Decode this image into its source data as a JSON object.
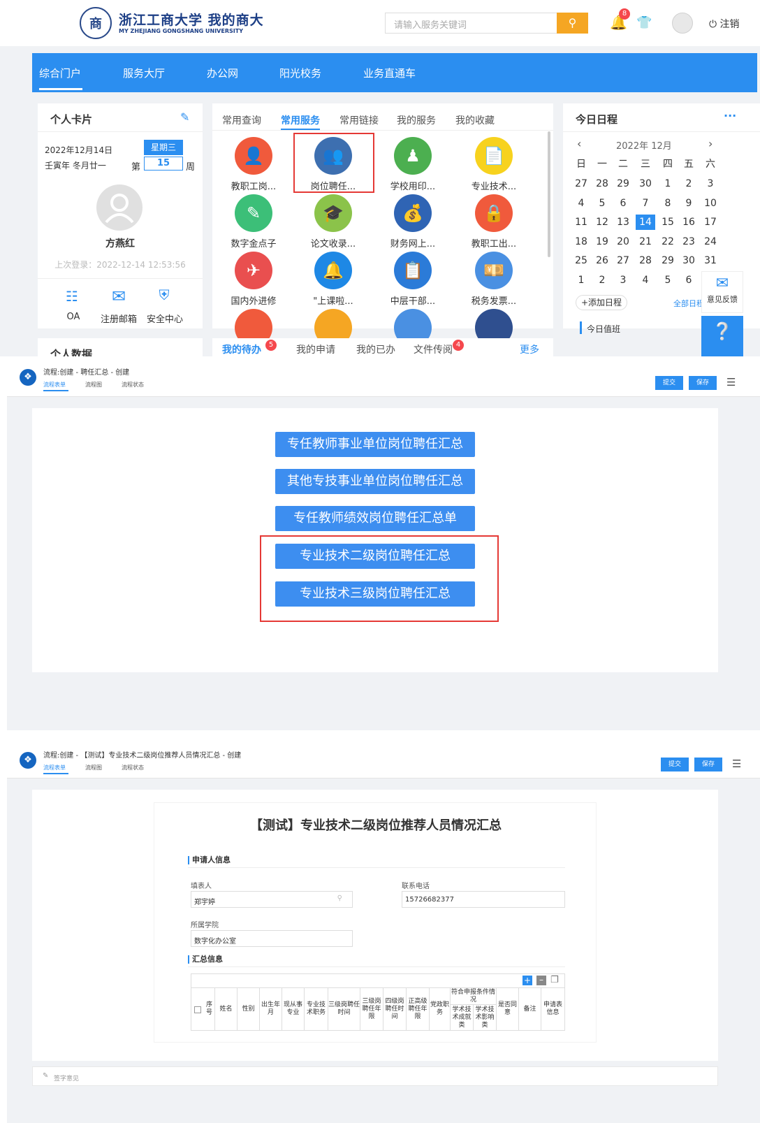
{
  "portal": {
    "logo": {
      "cn": "浙江工商大学",
      "cn2": "我的商大",
      "en": "MY ZHEJIANG GONGSHANG UNIVERSITY",
      "seal": "商"
    },
    "search": {
      "placeholder": "请输入服务关键词",
      "icon": "search-icon"
    },
    "notifications": {
      "count": "8",
      "icon": "bell-icon"
    },
    "shirt_icon": "tshirt-icon",
    "logout": "注销",
    "nav": [
      "综合门户",
      "服务大厅",
      "办公网",
      "阳光校务",
      "业务直通车"
    ],
    "personal_card": {
      "title": "个人卡片",
      "date": "2022年12月14日",
      "lunar": "壬寅年 冬月廿一",
      "weekday": "星期三",
      "week_prefix": "第",
      "week_num": "15",
      "week_suffix": "周",
      "name": "方燕红",
      "last_login": "上次登录：2022-12-14 12:53:56",
      "links": [
        "OA",
        "注册邮箱",
        "安全中心"
      ],
      "next_title": "个人数据"
    },
    "service_tabs": [
      "常用查询",
      "常用服务",
      "常用链接",
      "我的服务",
      "我的收藏"
    ],
    "services": [
      {
        "label": "教职工岗...",
        "color": "#f05a3c"
      },
      {
        "label": "岗位聘任...",
        "color": "#3d6fb0"
      },
      {
        "label": "学校用印...",
        "color": "#4caf50"
      },
      {
        "label": "专业技术...",
        "color": "#f7d21e"
      },
      {
        "label": "数字金点子",
        "color": "#3cbf78"
      },
      {
        "label": "论文收录...",
        "color": "#8bc34a"
      },
      {
        "label": "财务网上...",
        "color": "#2f64b4"
      },
      {
        "label": "教职工出...",
        "color": "#f05a3c"
      },
      {
        "label": "国内外进修",
        "color": "#e94f4f"
      },
      {
        "label": "\"上课啦...",
        "color": "#1e88e5"
      },
      {
        "label": "中层干部...",
        "color": "#2b7bd8"
      },
      {
        "label": "税务发票...",
        "color": "#4a90e2"
      }
    ],
    "todo_tabs": [
      "我的待办",
      "我的申请",
      "我的已办",
      "文件传阅"
    ],
    "todo_badges": [
      "5",
      "4"
    ],
    "todo_more": "更多",
    "schedule": {
      "title": "今日日程",
      "month": "2022年  12月",
      "weekdays": [
        "日",
        "一",
        "二",
        "三",
        "四",
        "五",
        "六"
      ],
      "days": [
        [
          "27",
          "28",
          "29",
          "30",
          "1",
          "2",
          "3"
        ],
        [
          "4",
          "5",
          "6",
          "7",
          "8",
          "9",
          "10"
        ],
        [
          "11",
          "12",
          "13",
          "14",
          "15",
          "16",
          "17"
        ],
        [
          "18",
          "19",
          "20",
          "21",
          "22",
          "23",
          "24"
        ],
        [
          "25",
          "26",
          "27",
          "28",
          "29",
          "30",
          "31"
        ],
        [
          "1",
          "2",
          "3",
          "4",
          "5",
          "6",
          ""
        ]
      ],
      "today": "14",
      "add": "+添加日程",
      "all": "全部日程",
      "duty": "今日值班",
      "feedback": "意见反馈"
    }
  },
  "flow1": {
    "title": "流程:创建 - 聘任汇总 - 创建",
    "tabs": [
      "流程表单",
      "流程图",
      "流程状态"
    ],
    "submit": "提交",
    "save": "保存",
    "buttons": [
      "专任教师事业单位岗位聘任汇总",
      "其他专技事业单位岗位聘任汇总",
      "专任教师绩效岗位聘任汇总单",
      "专业技术二级岗位聘任汇总",
      "专业技术三级岗位聘任汇总"
    ]
  },
  "flow2": {
    "title": "流程:创建 - 【测试】专业技术二级岗位推荐人员情况汇总 - 创建",
    "tabs": [
      "流程表单",
      "流程图",
      "流程状态"
    ],
    "submit": "提交",
    "save": "保存",
    "form_title": "【测试】专业技术二级岗位推荐人员情况汇总",
    "applicant_section": "申请人信息",
    "filler_label": "填表人",
    "filler_value": "郑宇婷",
    "phone_label": "联系电话",
    "phone_value": "15726682377",
    "college_label": "所属学院",
    "college_value": "数字化办公室",
    "summary_section": "汇总信息",
    "table_headers": [
      "序号",
      "姓名",
      "性别",
      "出生年月",
      "现从事专业",
      "专业技术职务",
      "三级岗聘任时间",
      "三级岗聘任年限",
      "四级岗聘任时间",
      "正高级聘任年限",
      "党政职务",
      "符合申报条件情况",
      "学术技术成就类",
      "学术技术影响类",
      "是否同意",
      "备注",
      "申请表信息"
    ],
    "opinion": "签字意见"
  }
}
